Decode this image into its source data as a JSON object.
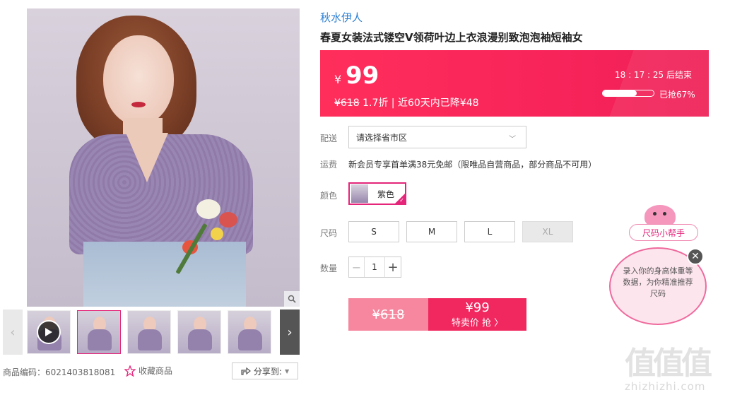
{
  "product": {
    "brand": "秋水伊人",
    "title": "春夏女装法式镂空V领荷叶边上衣浪漫别致泡泡袖短袖女",
    "sku_label": "商品编码：6021403818081",
    "favorite_label": "收藏商品",
    "share_label": "分享到:"
  },
  "price": {
    "currency": "¥",
    "current": "99",
    "original": "¥618",
    "discount_note": "1.7折 | 近60天内已降¥48",
    "countdown": "18 : 17 : 25  后结束",
    "sold_progress": 0.67,
    "sold_label": "已抢67%"
  },
  "options": {
    "delivery_label": "配送",
    "delivery_placeholder": "请选择省市区",
    "shipping_label": "运费",
    "shipping_text": "新会员专享首单满38元免邮（限唯品自营商品，部分商品不可用）",
    "color_label": "颜色",
    "color_value": "紫色",
    "size_label": "尺码",
    "sizes": [
      {
        "label": "S",
        "available": true
      },
      {
        "label": "M",
        "available": true
      },
      {
        "label": "L",
        "available": true
      },
      {
        "label": "XL",
        "available": false
      }
    ],
    "qty_label": "数量",
    "qty_value": "1",
    "qty_minus": "−",
    "qty_plus": "+"
  },
  "buy_button": {
    "old_price": "¥618",
    "new_price": "¥99",
    "action": "特卖价 抢 〉"
  },
  "size_helper": {
    "tag": "尺码小帮手",
    "bubble_text": "录入你的身高体重等数据，为你精准推荐尺码",
    "close": "✕"
  },
  "watermark": {
    "logo": "值值值",
    "url": "zhizhizhi.com"
  },
  "icons": {
    "zoom": "zoom-icon",
    "play": "play-icon",
    "star": "star-icon",
    "share": "share-icon",
    "chevron": "chevron-down-icon"
  },
  "colors": {
    "accent": "#f0285f",
    "brand_link": "#2b7ed2",
    "selected_border": "#e4257a"
  }
}
